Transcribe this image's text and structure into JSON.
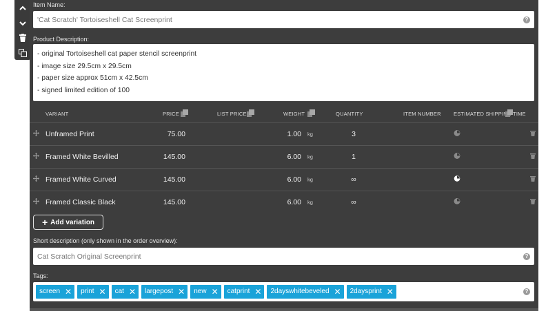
{
  "toolbar": {
    "icons": [
      "chevron-up-icon",
      "chevron-down-icon",
      "trash-icon",
      "duplicate-icon"
    ]
  },
  "item_name": {
    "label": "Item Name:",
    "value": "'Cat Scratch' Tortoiseshell Cat Screenprint"
  },
  "product_description": {
    "label": "Product Description:",
    "lines": [
      "- original Tortoiseshell cat paper stencil screenprint",
      "- image size 29.5cm x 29.5cm",
      "- paper size approx 51cm x 42.5cm",
      "- signed limited edition of 100"
    ]
  },
  "variants": {
    "headers": {
      "variant": "VARIANT",
      "price": "PRICE",
      "list_price": "LIST PRICE",
      "weight": "WEIGHT",
      "quantity": "QUANTITY",
      "item_number": "ITEM NUMBER",
      "shipping": "ESTIMATED SHIPPING TIME"
    },
    "rows": [
      {
        "name": "Unframed Print",
        "price": "75.00",
        "weight": "1.00",
        "unit": "kg",
        "quantity": "3",
        "shipping_selected": 0
      },
      {
        "name": "Framed White Bevilled",
        "price": "145.00",
        "weight": "6.00",
        "unit": "kg",
        "quantity": "1",
        "shipping_selected": 0
      },
      {
        "name": "Framed White Curved",
        "price": "145.00",
        "weight": "6.00",
        "unit": "kg",
        "quantity": "∞",
        "shipping_selected": 2
      },
      {
        "name": "Framed Classic Black",
        "price": "145.00",
        "weight": "6.00",
        "unit": "kg",
        "quantity": "∞",
        "shipping_selected": 1
      }
    ],
    "add_label": "Add variation"
  },
  "short_description": {
    "label": "Short description (only shown in the order overview):",
    "value": "Cat Scratch Original Screenprint"
  },
  "tags": {
    "label": "Tags:",
    "items": [
      "screen",
      "print",
      "cat",
      "largepost",
      "new",
      "catprint",
      "2dayswhitebeveled",
      "2daysprint"
    ]
  },
  "colors": {
    "panel": "#3d3d3d",
    "tag": "#1aa3d9"
  }
}
